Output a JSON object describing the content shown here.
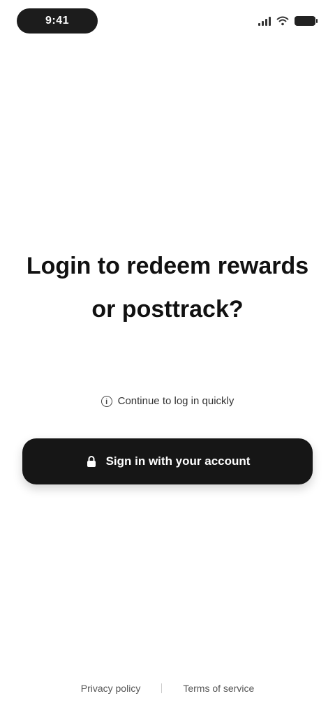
{
  "status_bar": {
    "time": "9:41",
    "icons": [
      "signal-icon",
      "wifi-icon",
      "battery-icon"
    ]
  },
  "hero": {
    "headline": "Login to redeem rewards or posttrack?"
  },
  "subtitle": {
    "text": "Continue to log in quickly",
    "icon": "info-icon"
  },
  "primary_button": {
    "label": "Sign in with your account",
    "icon": "lock-icon"
  },
  "footer": {
    "links": [
      {
        "label": "Privacy policy"
      },
      {
        "label": "Terms of service"
      }
    ]
  },
  "colors": {
    "background": "#ffffff",
    "text": "#111111",
    "button": "#161616",
    "button_text": "#ffffff"
  }
}
